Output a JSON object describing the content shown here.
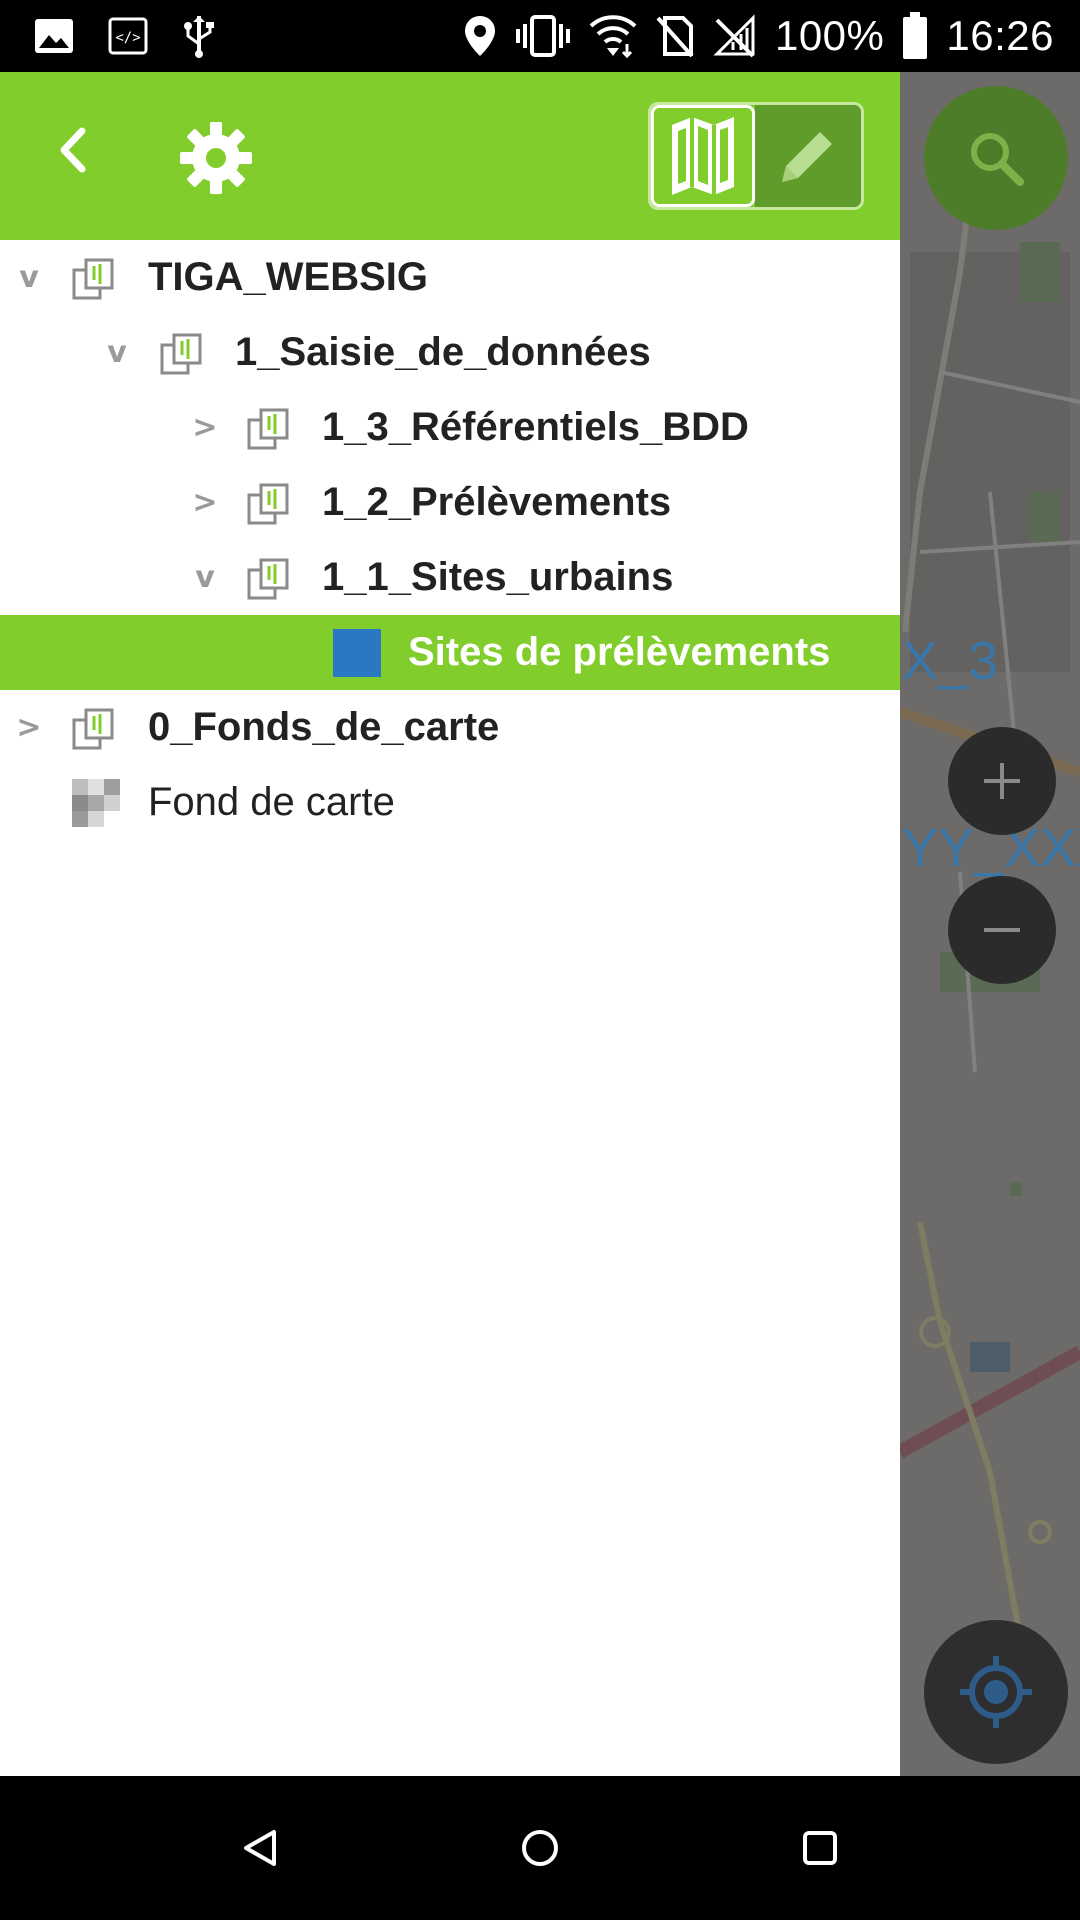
{
  "status_bar": {
    "left_icons": [
      "image-icon",
      "code-icon",
      "usb-icon"
    ],
    "right_icons": [
      "location-icon",
      "vibrate-icon",
      "wifi-icon",
      "no-sim-icon",
      "no-signal-icon"
    ],
    "battery": "100%",
    "time": "16:26"
  },
  "drawer": {
    "header_color": "#80cd2b",
    "selected_color": "#80cd2b",
    "tree": [
      {
        "label": "TIGA_WEBSIG",
        "level": 0,
        "chevron": "v",
        "type": "group",
        "bold": true
      },
      {
        "label": "1_Saisie_de_données",
        "level": 1,
        "chevron": "v",
        "type": "group",
        "bold": true
      },
      {
        "label": "1_3_Référentiels_BDD",
        "level": 2,
        "chevron": ">",
        "type": "group",
        "bold": true
      },
      {
        "label": "1_2_Prélèvements",
        "level": 2,
        "chevron": ">",
        "type": "group",
        "bold": true
      },
      {
        "label": "1_1_Sites_urbains",
        "level": 2,
        "chevron": "v",
        "type": "group",
        "bold": true
      },
      {
        "label": "Sites de prélèvements",
        "level": 3,
        "chevron": "",
        "type": "vector",
        "bold": true,
        "selected": true,
        "swatch_color": "#2a77c2"
      },
      {
        "label": "0_Fonds_de_carte",
        "level": 0,
        "chevron": ">",
        "type": "group",
        "bold": true
      },
      {
        "label": "Fond de carte",
        "level": 0,
        "chevron": "",
        "type": "raster",
        "bold": false
      }
    ]
  },
  "map": {
    "labels": [
      "X_3",
      "YY_XXX"
    ]
  }
}
